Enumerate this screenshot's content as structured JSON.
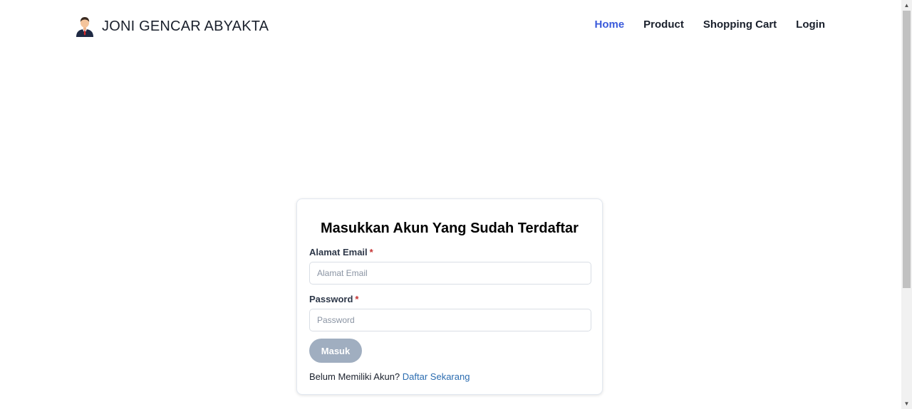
{
  "brand": {
    "name": "JONI GENCAR ABYAKTA",
    "logo_icon": "businessman-avatar-icon"
  },
  "nav": {
    "items": [
      {
        "label": "Home",
        "active": true
      },
      {
        "label": "Product",
        "active": false
      },
      {
        "label": "Shopping Cart",
        "active": false
      },
      {
        "label": "Login",
        "active": false
      }
    ]
  },
  "login_card": {
    "title": "Masukkan Akun Yang Sudah Terdaftar",
    "email": {
      "label": "Alamat Email",
      "required_mark": "*",
      "value": "",
      "placeholder": "Alamat Email"
    },
    "password": {
      "label": "Password",
      "required_mark": "*",
      "value": "",
      "placeholder": "Password"
    },
    "submit_label": "Masuk",
    "register_prompt": "Belum Memiliki Akun?",
    "register_link": "Daftar Sekarang"
  },
  "colors": {
    "nav_active": "#3b5bdb",
    "button_bg": "#a0aec0",
    "link": "#2b6cb0"
  }
}
